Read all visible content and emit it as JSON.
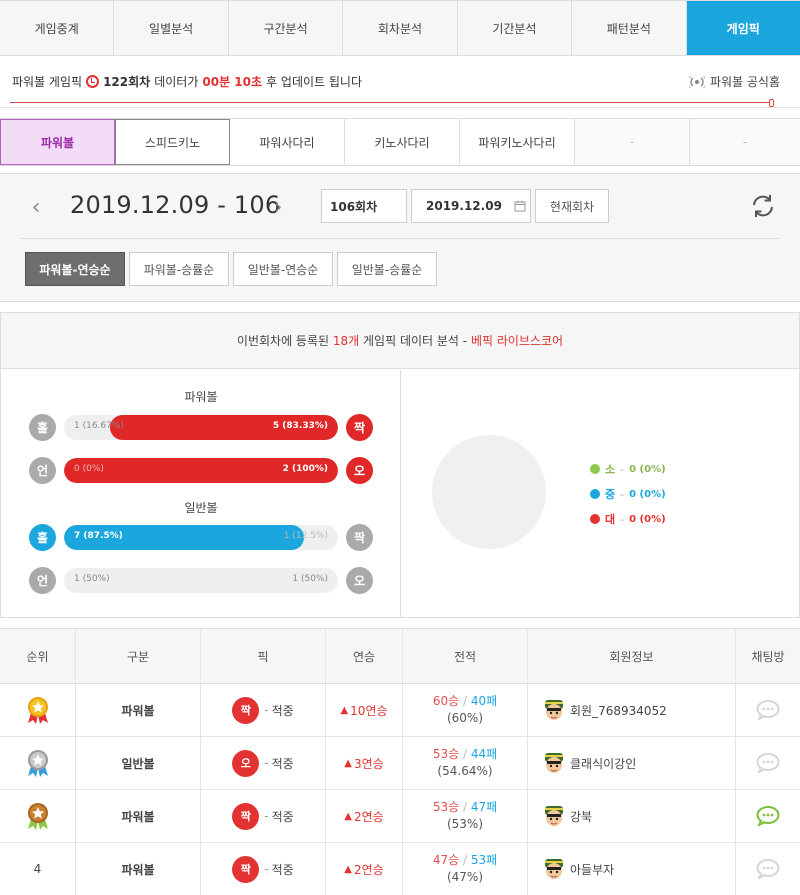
{
  "topnav": [
    "게임중계",
    "일별분석",
    "구간분석",
    "회차분석",
    "기간분석",
    "패턴분석",
    "게임픽"
  ],
  "update": {
    "prefix": "파워볼 게임픽",
    "round": "122회차",
    "mid": "데이터가",
    "time": "00분 10초",
    "suffix": "후 업데이트 됩니다",
    "official": "파워볼 공식홈"
  },
  "gametabs": [
    "파워볼",
    "스피드키노",
    "파워사다리",
    "키노사다리",
    "파워키노사다리",
    "-",
    "-"
  ],
  "datebar": {
    "title": "2019.12.09 - 106",
    "round_box": "106회차",
    "date_box": "2019.12.09",
    "current_btn": "현재회차",
    "prev": "‹",
    "next": "›"
  },
  "sorts": [
    "파워볼-연승순",
    "파워볼-승률순",
    "일반볼-연승순",
    "일반볼-승률순"
  ],
  "analysis": {
    "head_pre": "이번회차에 등록된",
    "count": "18개",
    "head_mid": "게임픽 데이터 분석 -",
    "brand": "베픽 라이브스코어",
    "powerball_label": "파워볼",
    "normal_label": "일반볼",
    "rows": [
      {
        "left": "홀",
        "right": "짝",
        "left_text": "1 (16.67%)",
        "right_text": "5 (83.33%)"
      },
      {
        "left": "언",
        "right": "오",
        "left_text": "0 (0%)",
        "right_text": "2 (100%)"
      },
      {
        "left": "홀",
        "right": "짝",
        "left_text": "7 (87.5%)",
        "right_text": "1 (12.5%)"
      },
      {
        "left": "언",
        "right": "오",
        "left_text": "1 (50%)",
        "right_text": "1 (50%)"
      }
    ],
    "legend": [
      {
        "label": "소",
        "value": "0 (0%)",
        "color": "#8ec84a"
      },
      {
        "label": "중",
        "value": "0 (0%)",
        "color": "#1ba6dd"
      },
      {
        "label": "대",
        "value": "0 (0%)",
        "color": "#e23232"
      }
    ]
  },
  "colors": {
    "red": "#e23232",
    "blue": "#1ba6dd",
    "gray": "#aaaaaa"
  },
  "rank": {
    "headers": [
      "순위",
      "구분",
      "픽",
      "연승",
      "전적",
      "회원정보",
      "채팅방"
    ],
    "rows": [
      {
        "rank": "",
        "medal": "gold",
        "type": "파워볼",
        "pick": "짝",
        "hit": "적중",
        "streak": "10연승",
        "wins": "60승",
        "losses": "40패",
        "pct": "(60%)",
        "member": "회원_768934052",
        "chat_active": false
      },
      {
        "rank": "",
        "medal": "silver",
        "type": "일반볼",
        "pick": "오",
        "hit": "적중",
        "streak": "3연승",
        "wins": "53승",
        "losses": "44패",
        "pct": "(54.64%)",
        "member": "클래식이강인",
        "chat_active": false
      },
      {
        "rank": "",
        "medal": "bronze",
        "type": "파워볼",
        "pick": "짝",
        "hit": "적중",
        "streak": "2연승",
        "wins": "53승",
        "losses": "47패",
        "pct": "(53%)",
        "member": "강북",
        "chat_active": true
      },
      {
        "rank": "4",
        "medal": "",
        "type": "파워볼",
        "pick": "짝",
        "hit": "적중",
        "streak": "2연승",
        "wins": "47승",
        "losses": "53패",
        "pct": "(47%)",
        "member": "아들부자",
        "chat_active": false
      }
    ]
  }
}
